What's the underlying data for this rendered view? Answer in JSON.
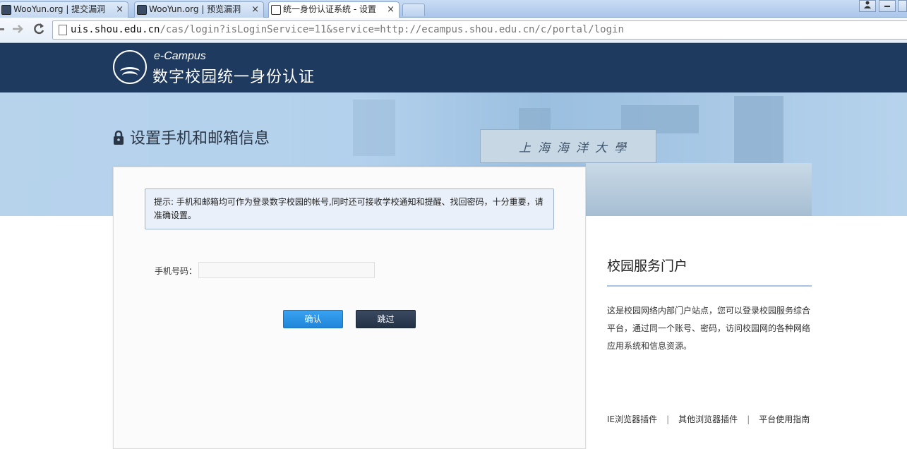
{
  "browser": {
    "tabs": [
      {
        "label": "WooYun.org | 提交漏洞"
      },
      {
        "label": "WooYun.org | 预览漏洞"
      },
      {
        "label": "统一身份认证系统 - 设置"
      }
    ],
    "tab_close_glyph": "×",
    "url_host": "uis.shou.edu.cn",
    "url_path": "/cas/login?isLoginService=11&service=http://ecampus.shou.edu.cn/c/portal/login"
  },
  "header": {
    "brand_small": "e-Campus",
    "brand_main": "数字校园统一身份认证"
  },
  "banner": {
    "title": "设置手机和邮箱信息",
    "gate_text": "上海海洋大學"
  },
  "form": {
    "notice": "提示: 手机和邮箱均可作为登录数字校园的帐号,同时还可接收学校通知和提醒、找回密码，十分重要，请准确设置。",
    "phone_label": "手机号码：",
    "phone_value": "",
    "confirm_label": "确认",
    "skip_label": "跳过"
  },
  "sidebar": {
    "title": "校园服务门户",
    "description": "这是校园网络内部门户站点，您可以登录校园服务综合平台，通过同一个账号、密码，访问校园网的各种网络应用系统和信息资源。",
    "links": [
      {
        "label": "IE浏览器插件"
      },
      {
        "label": "其他浏览器插件"
      },
      {
        "label": "平台使用指南"
      }
    ],
    "link_separator": "|"
  },
  "colors": {
    "header_bg": "#1f3a5f",
    "banner_bg": "#b7d3ec",
    "confirm_button": "#2b94e6",
    "skip_button": "#2e3c52",
    "notice_bg": "#e9f0f9"
  },
  "icons": [
    "lock-icon",
    "back-icon",
    "forward-icon",
    "reload-icon",
    "page-icon",
    "close-icon",
    "user-icon",
    "minimize-icon"
  ]
}
